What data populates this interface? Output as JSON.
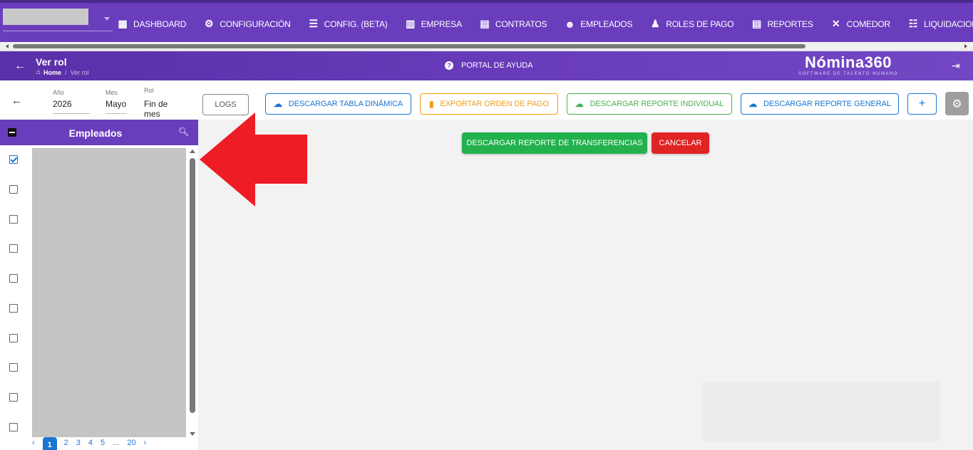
{
  "nav": {
    "items": [
      {
        "label": "DASHBOARD",
        "icon": "dashboard-icon"
      },
      {
        "label": "CONFIGURACIÓN",
        "icon": "gear-icon"
      },
      {
        "label": "CONFIG. (BETA)",
        "icon": "sliders-icon"
      },
      {
        "label": "EMPRESA",
        "icon": "building-icon"
      },
      {
        "label": "CONTRATOS",
        "icon": "clipboard-icon"
      },
      {
        "label": "EMPLEADOS",
        "icon": "face-icon"
      },
      {
        "label": "ROLES DE PAGO",
        "icon": "people-icon"
      },
      {
        "label": "REPORTES",
        "icon": "clipboard-icon"
      },
      {
        "label": "COMEDOR",
        "icon": "utensils-icon"
      },
      {
        "label": "LIQUIDACIONES",
        "icon": "list-icon"
      }
    ]
  },
  "header": {
    "title": "Ver rol",
    "breadcrumb": {
      "home": "Home",
      "separator": "/",
      "current": "Ver rol"
    },
    "help": "PORTAL DE AYUDA",
    "brand": {
      "name": "Nómina360",
      "tagline": "SOFTWARE DE TALENTO HUMANO"
    }
  },
  "filters": {
    "year": {
      "label": "Año",
      "value": "2026"
    },
    "month": {
      "label": "Mes",
      "value": "Mayo"
    },
    "rol": {
      "label": "Rol",
      "value": "Fin de mes"
    }
  },
  "toolbar": {
    "logs": "LOGS",
    "tabla": "DESCARGAR TABLA DINÁMICA",
    "exportar": "EXPORTAR ORDEN DE PAGO",
    "individual": "DESCARGAR REPORTE INDIVIDUAL",
    "general": "DESCARGAR REPORTE GENERAL",
    "plus": "+"
  },
  "employees": {
    "title": "Empleados",
    "rows_checked": [
      true,
      false,
      false,
      false,
      false,
      false,
      false,
      false,
      false,
      false
    ],
    "pagination": {
      "prev": "‹",
      "pages": [
        "1",
        "2",
        "3",
        "4",
        "5"
      ],
      "ellipsis": "...",
      "last": "20",
      "next": "›",
      "current": "1"
    }
  },
  "actions": {
    "transfer": "DESCARGAR REPORTE DE TRANSFERENCIAS",
    "cancel": "CANCELAR"
  },
  "colors": {
    "primary": "#6a3dbd",
    "blue": "#1976d2",
    "orange": "#f39c12",
    "green": "#4caf50",
    "transfer_green": "#22b14c",
    "danger": "#e02424",
    "arrow_red": "#ee1c24"
  }
}
